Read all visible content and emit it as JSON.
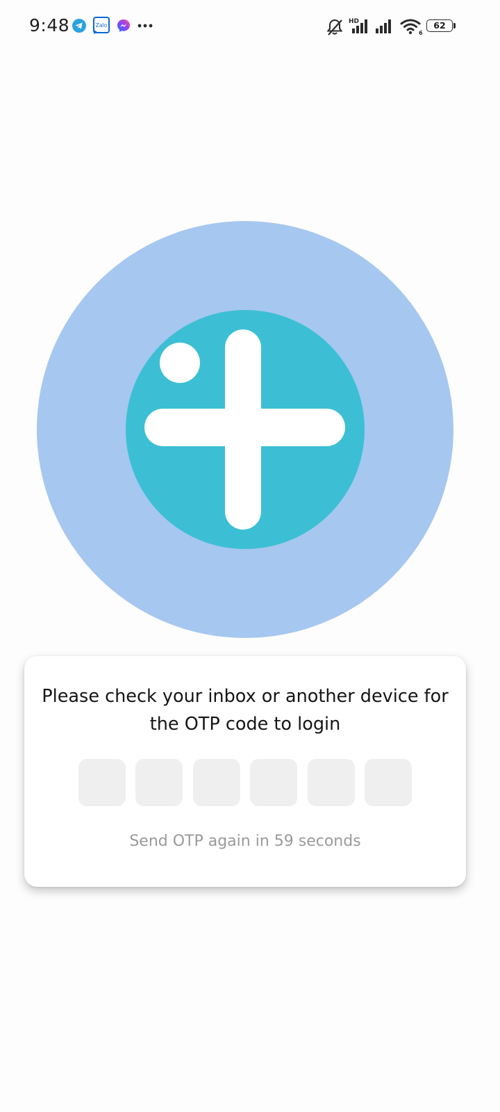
{
  "status_bar": {
    "time": "9:48",
    "notification_icons": [
      "telegram-icon",
      "zalo-icon",
      "messenger-icon",
      "more-notifications-icon"
    ],
    "zalo_label": "Zalo",
    "network_label": "HD",
    "wifi_label": "6",
    "battery_level": "62",
    "system_icons": [
      "mute-icon",
      "signal-icon",
      "signal-icon",
      "wifi-icon",
      "battery-icon"
    ]
  },
  "logo": {
    "name": "medical-cross-logo",
    "outer_color": "#a6c7ef",
    "inner_color": "#3cbfd4",
    "cross_color": "#ffffff"
  },
  "otp": {
    "prompt": "Please check your inbox or another device for the OTP code to login",
    "digits": [
      "",
      "",
      "",
      "",
      "",
      ""
    ],
    "resend_text": "Send OTP again in 59 seconds"
  },
  "colors": {
    "background": "#fdfdfd",
    "card": "#ffffff",
    "input_box": "#efefef",
    "muted_text": "#9a9a9a"
  }
}
